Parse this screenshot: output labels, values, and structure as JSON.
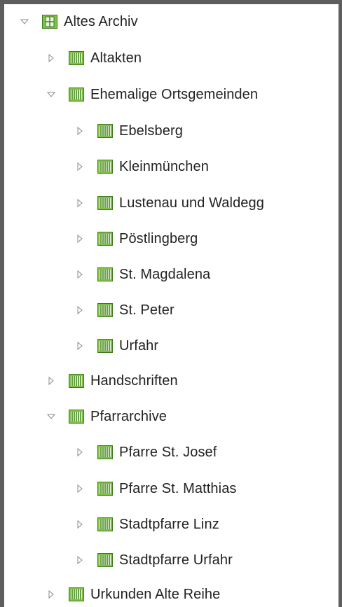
{
  "tree": {
    "root": {
      "label": "Altes Archiv",
      "expanded": true,
      "icon": "archive-root-icon"
    },
    "altakten": {
      "label": "Altakten",
      "expanded": false,
      "icon": "collection-icon"
    },
    "ehemalige": {
      "label": "Ehemalige Ortsgemeinden",
      "expanded": true,
      "icon": "collection-icon"
    },
    "ebelsberg": {
      "label": "Ebelsberg",
      "expanded": false,
      "icon": "collection-icon"
    },
    "kleinmuenchen": {
      "label": "Kleinmünchen",
      "expanded": false,
      "icon": "collection-icon"
    },
    "lustenau": {
      "label": "Lustenau und Waldegg",
      "expanded": false,
      "icon": "collection-icon"
    },
    "poestlingberg": {
      "label": "Pöstlingberg",
      "expanded": false,
      "icon": "collection-icon"
    },
    "magdalena": {
      "label": "St. Magdalena",
      "expanded": false,
      "icon": "collection-icon"
    },
    "peter": {
      "label": "St. Peter",
      "expanded": false,
      "icon": "collection-icon"
    },
    "urfahr": {
      "label": "Urfahr",
      "expanded": false,
      "icon": "collection-icon"
    },
    "handschriften": {
      "label": "Handschriften",
      "expanded": false,
      "icon": "collection-icon"
    },
    "pfarrarchive": {
      "label": "Pfarrarchive",
      "expanded": true,
      "icon": "collection-icon"
    },
    "josef": {
      "label": "Pfarre St. Josef",
      "expanded": false,
      "icon": "collection-icon"
    },
    "matthias": {
      "label": "Pfarre St. Matthias",
      "expanded": false,
      "icon": "collection-icon"
    },
    "stadtlinz": {
      "label": "Stadtpfarre Linz",
      "expanded": false,
      "icon": "collection-icon"
    },
    "stadturfahr": {
      "label": "Stadtpfarre Urfahr",
      "expanded": false,
      "icon": "collection-icon"
    },
    "urkunden": {
      "label": "Urkunden Alte Reihe",
      "expanded": false,
      "icon": "collection-icon"
    }
  },
  "colors": {
    "icon_green": "#7dc242",
    "icon_dark": "#3f7a20",
    "toggle_gray": "#8c8c8c",
    "text": "#222222",
    "frame": "#5e5e5e"
  }
}
